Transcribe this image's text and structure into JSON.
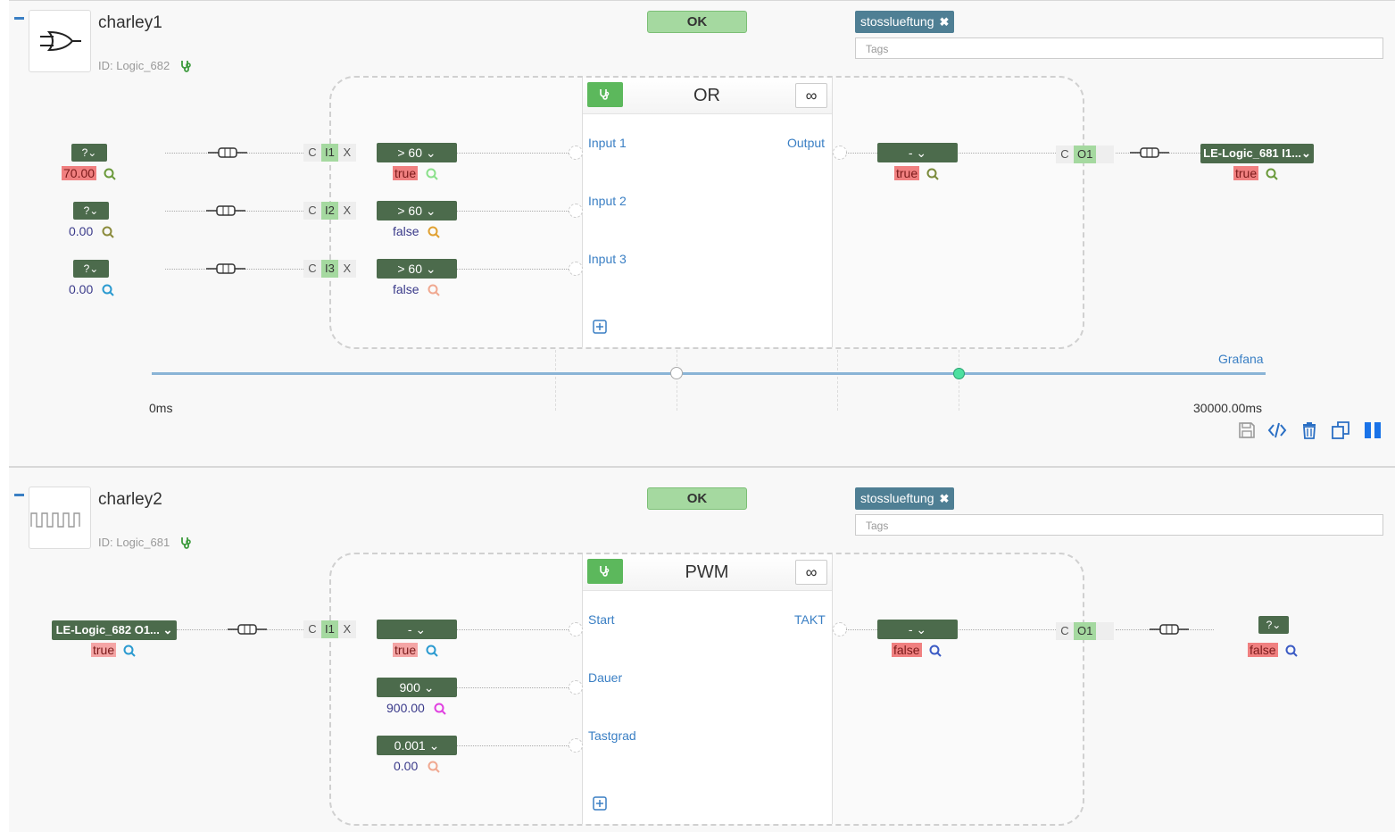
{
  "blocks": [
    {
      "name": "charley1",
      "id_label": "ID: Logic_682",
      "status": "OK",
      "tag": "stosslueftung",
      "tags_placeholder": "Tags",
      "type": "OR",
      "infinite_label": "∞",
      "logo": "or-gate-icon",
      "inputs": [
        {
          "label": "Input 1",
          "port": "I1",
          "src_value": "70.00",
          "src_highlight": "red",
          "filter": "> 60",
          "filtered_value": "true",
          "filtered_highlight": "red"
        },
        {
          "label": "Input 2",
          "port": "I2",
          "src_value": "0.00",
          "src_highlight": "none",
          "filter": "> 60",
          "filtered_value": "false",
          "filtered_highlight": "none"
        },
        {
          "label": "Input 3",
          "port": "I3",
          "src_value": "0.00",
          "src_highlight": "none",
          "filter": "> 60",
          "filtered_value": "false",
          "filtered_highlight": "none"
        }
      ],
      "output": {
        "label": "Output",
        "port": "O1",
        "filter": "-",
        "value": "true",
        "target": "LE-Logic_681 I1...",
        "target_value": "true"
      },
      "timeline": {
        "start": "0ms",
        "end": "30000.00ms",
        "grafana": "Grafana"
      }
    },
    {
      "name": "charley2",
      "id_label": "ID: Logic_681",
      "status": "OK",
      "tag": "stosslueftung",
      "tags_placeholder": "Tags",
      "type": "PWM",
      "infinite_label": "∞",
      "logo": "pwm-wave-icon",
      "source": {
        "label": "LE-Logic_682 O1...",
        "value": "true",
        "port": "I1"
      },
      "inputs": [
        {
          "label": "Start",
          "filter": "-",
          "value": "true",
          "highlight": "pink"
        },
        {
          "label": "Dauer",
          "filter": "900",
          "value": "900.00",
          "highlight": "none"
        },
        {
          "label": "Tastgrad",
          "filter": "0.001",
          "value": "0.00",
          "highlight": "none"
        }
      ],
      "output": {
        "label": "TAKT",
        "port": "O1",
        "filter": "-",
        "value": "false",
        "target_value": "false"
      }
    }
  ],
  "colors": {
    "accent": "#3a7fc4",
    "ok_bg": "#a5d9a0",
    "tag_bg": "#4f7f94",
    "selector_bg": "#4c6b4c",
    "true_bg": "#f08080"
  }
}
